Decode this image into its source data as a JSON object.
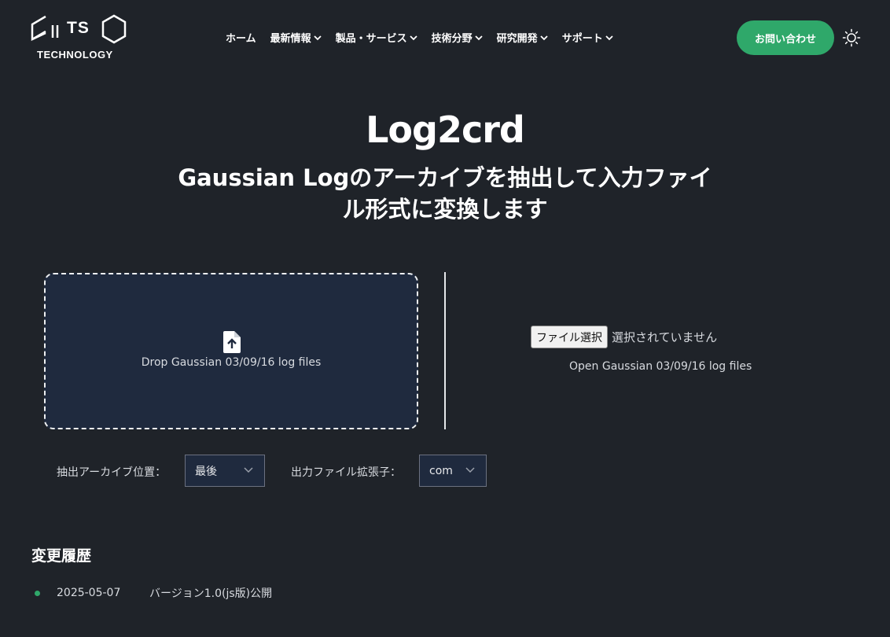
{
  "header": {
    "logo_text": "TS",
    "logo_subtext": "TECHNOLOGY",
    "nav": [
      {
        "label": "ホーム",
        "has_dropdown": false
      },
      {
        "label": "最新情報",
        "has_dropdown": true
      },
      {
        "label": "製品・サービス",
        "has_dropdown": true
      },
      {
        "label": "技術分野",
        "has_dropdown": true
      },
      {
        "label": "研究開発",
        "has_dropdown": true
      },
      {
        "label": "サポート",
        "has_dropdown": true
      }
    ],
    "contact_label": "お問い合わせ",
    "theme_icon": "sun-icon"
  },
  "main": {
    "title": "Log2crd",
    "subtitle": "Gaussian Logのアーカイブを抽出して入力ファイル形式に変換します",
    "dropzone_label": "Drop Gaussian 03/09/16 log files",
    "file_button_label": "ファイル選択",
    "file_status": "選択されていません",
    "open_label": "Open Gaussian 03/09/16 log files",
    "archive_position_label": "抽出アーカイブ位置：",
    "archive_position_value": "最後",
    "extension_label": "出力ファイル拡張子：",
    "extension_value": "com"
  },
  "history": {
    "title": "変更履歴",
    "entries": [
      {
        "date": "2025-05-07",
        "text": "バージョン1.0(js版)公開"
      }
    ]
  },
  "colors": {
    "background": "#1f2329",
    "accent": "#2fa86a",
    "dropzone_bg": "#1f2a3e"
  }
}
